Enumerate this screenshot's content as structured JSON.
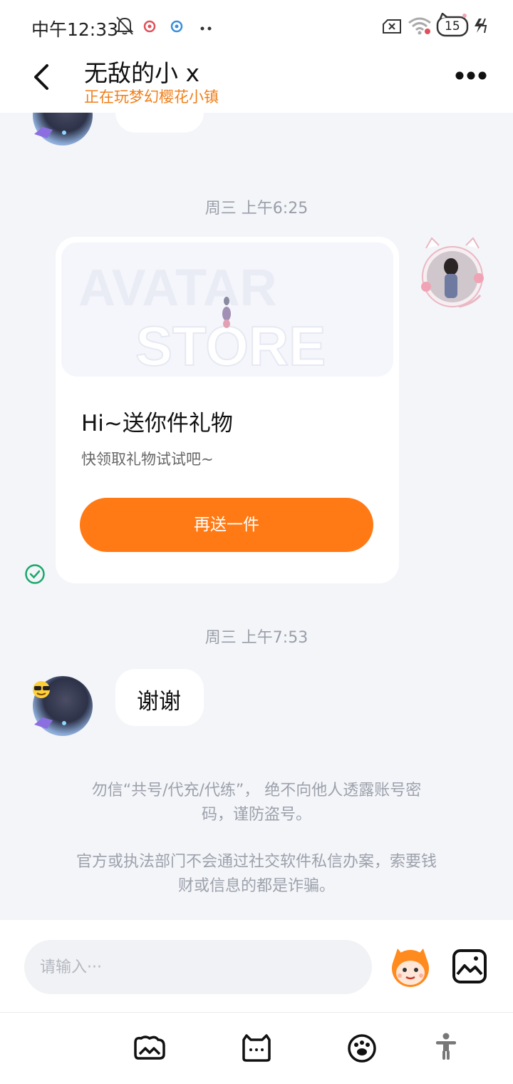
{
  "status_bar": {
    "time": "中午12:33",
    "battery": "15",
    "icons": [
      "mute-bell-icon",
      "app-notification-icon",
      "app-notification-icon-2",
      "more-dots-icon",
      "sim-x-icon",
      "wifi-icon",
      "battery-icon",
      "charging-icon"
    ]
  },
  "header": {
    "title": "无敌的小 x",
    "subtitle": "正在玩梦幻樱花小镇",
    "back_icon": "chevron-left-icon",
    "more_icon": "more-horizontal-icon",
    "accent_color": "#f07f1a"
  },
  "chat": {
    "messages": [
      {
        "type": "timestamp",
        "text": "周三 上午6:25"
      },
      {
        "type": "gift_card",
        "sender": "me",
        "banner_text": [
          "AVATAR",
          "STORE"
        ],
        "title": "Hi~送你件礼物",
        "subtitle": "快领取礼物试试吧~",
        "button_label": "再送一件",
        "status_icon": "check-circle-icon"
      },
      {
        "type": "timestamp",
        "text": "周三 上午7:53"
      },
      {
        "type": "text",
        "sender": "other",
        "text": "谢谢"
      }
    ],
    "notices": [
      "勿信“共号/代充/代练”，绝不向他人透露账号密码，谨防盗号。",
      "官方或执法部门不会通过社交软件私信办案，索要钱财或信息的都是诈骗。"
    ],
    "notice_lines": [
      [
        "勿信“共号/代充/代练”， 绝不向他人透露账号密",
        "码，谨防盗号。"
      ],
      [
        "官方或执法部门不会通过社交软件私信办案，索要钱",
        "财或信息的都是诈骗。"
      ]
    ]
  },
  "input_bar": {
    "placeholder": "请输入···",
    "value": "",
    "sticker_icon": "monkey-sticker-icon",
    "image_icon": "image-icon"
  },
  "bottom_nav": {
    "items": [
      {
        "icon": "photo-cloud-icon"
      },
      {
        "icon": "cat-face-icon"
      },
      {
        "icon": "paw-icon"
      },
      {
        "icon": "accessibility-icon"
      }
    ]
  },
  "colors": {
    "accent_orange": "#ff7a14",
    "background": "#f3f5f9",
    "status_green": "#1aa86a"
  }
}
